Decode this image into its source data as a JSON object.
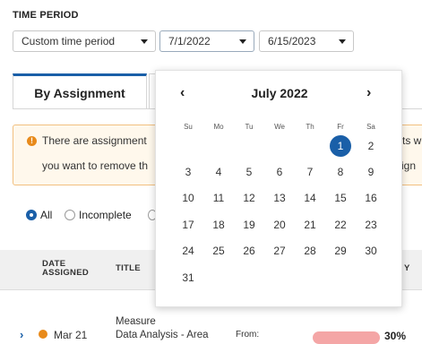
{
  "filters": {
    "section_label": "TIME PERIOD",
    "period_select": "Custom time period",
    "start_date": "7/1/2022",
    "end_date": "6/15/2023"
  },
  "tabs": {
    "active_label": "By Assignment"
  },
  "alert": {
    "line1": "There are assignment",
    "line2": "you want to remove th",
    "right1": "ts w",
    "right2": "sign"
  },
  "radios": {
    "all_label": "All",
    "incomplete_label": "Incomplete"
  },
  "table": {
    "date_header_line1": "DATE",
    "date_header_line2": "ASSIGNED",
    "title_header": "TITLE",
    "right_header": "Y",
    "row": {
      "date": "Mar 21",
      "title_line1": "Measure",
      "title_line2": "Data Analysis - Area",
      "from": "From:",
      "percent": "30%",
      "bar_value": 0.3,
      "bar_color": "#f4a6a6"
    }
  },
  "calendar": {
    "month_label": "July 2022",
    "weekdays": [
      "Su",
      "Mo",
      "Tu",
      "We",
      "Th",
      "Fr",
      "Sa"
    ],
    "selected_day": "1",
    "weeks": [
      [
        "",
        "",
        "",
        "",
        "",
        "1",
        "2"
      ],
      [
        "3",
        "4",
        "5",
        "6",
        "7",
        "8",
        "9"
      ],
      [
        "10",
        "11",
        "12",
        "13",
        "14",
        "15",
        "16"
      ],
      [
        "17",
        "18",
        "19",
        "20",
        "21",
        "22",
        "23"
      ],
      [
        "24",
        "25",
        "26",
        "27",
        "28",
        "29",
        "30"
      ],
      [
        "31",
        "",
        "",
        "",
        "",
        "",
        ""
      ]
    ],
    "accent_color": "#1a5fa8"
  }
}
